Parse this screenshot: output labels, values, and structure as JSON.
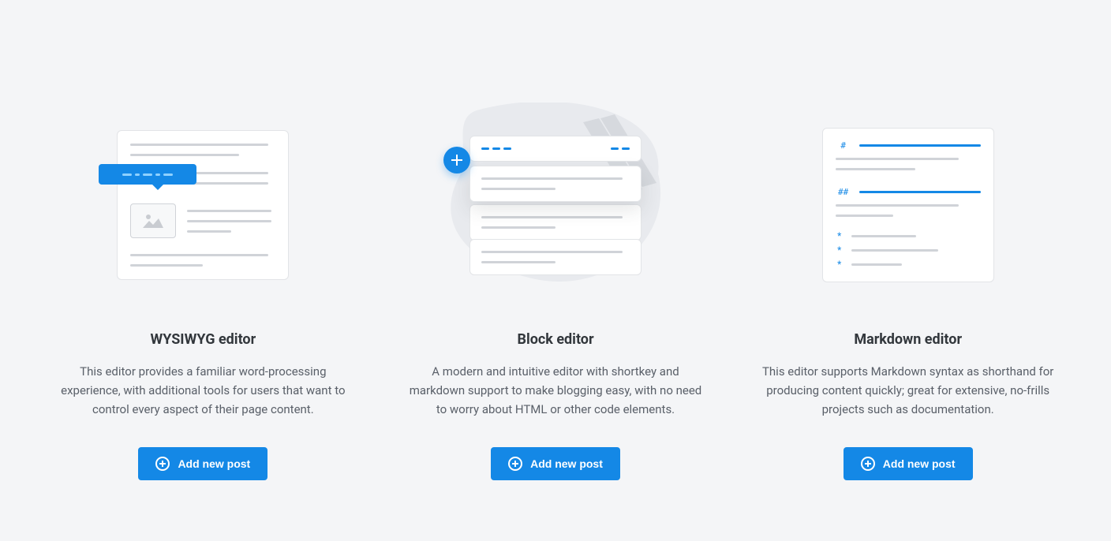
{
  "editors": {
    "wysiwyg": {
      "title": "WYSIWYG editor",
      "description": "This editor provides a familiar word-processing experience, with additional tools for users that want to control every aspect of their page content.",
      "button_label": "Add new post"
    },
    "block": {
      "title": "Block editor",
      "description": "A modern and intuitive editor with shortkey and markdown support to make blogging easy, with no need to worry about HTML or other code elements.",
      "button_label": "Add new post"
    },
    "markdown": {
      "title": "Markdown editor",
      "description": "This editor supports Markdown syntax as shorthand for producing content quickly; great for extensive, no-frills projects such as documentation.",
      "button_label": "Add new post",
      "symbols": {
        "h1": "#",
        "h2": "##",
        "bullet": "*"
      }
    }
  },
  "colors": {
    "accent": "#1488e6",
    "bg": "#f4f5f7",
    "text": "#32373c",
    "muted": "#5a6069"
  }
}
